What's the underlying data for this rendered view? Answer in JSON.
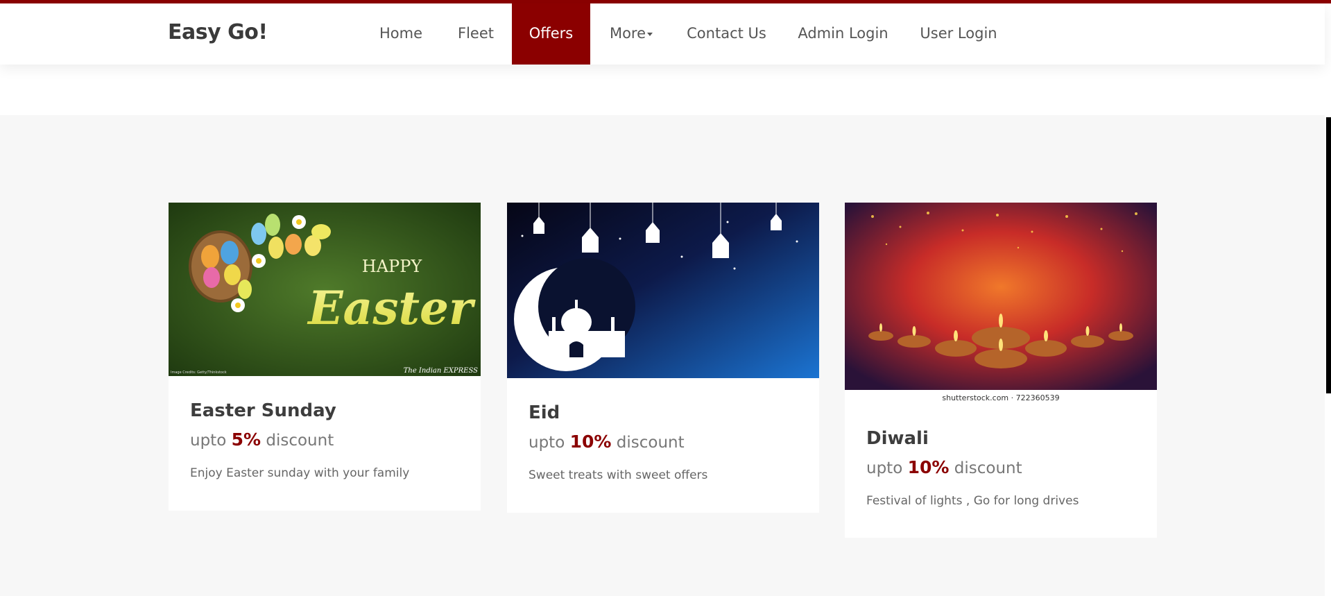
{
  "brand": "Easy Go!",
  "nav": {
    "home": "Home",
    "fleet": "Fleet",
    "offers": "Offers",
    "more": "More",
    "contact": "Contact Us",
    "admin": "Admin Login",
    "user": "User Login"
  },
  "colors": {
    "accent": "#8b0000",
    "section_bg": "#f7f7f7"
  },
  "offers": [
    {
      "title": "Easter Sunday",
      "prefix": "upto",
      "percent": "5%",
      "suffix": "discount",
      "description": "Enjoy Easter sunday with your family",
      "image_text_1": "HAPPY",
      "image_text_2": "Easter",
      "image_credit": "The Indian EXPRESS",
      "image_credit_small": "Image Credits: Getty/Thinkstock"
    },
    {
      "title": "Eid",
      "prefix": "upto",
      "percent": "10%",
      "suffix": "discount",
      "description": "Sweet treats with sweet offers"
    },
    {
      "title": "Diwali",
      "prefix": "upto",
      "percent": "10%",
      "suffix": "discount",
      "description": "Festival of lights , Go for long drives",
      "image_credit": "shutterstock.com · 722360539"
    }
  ]
}
